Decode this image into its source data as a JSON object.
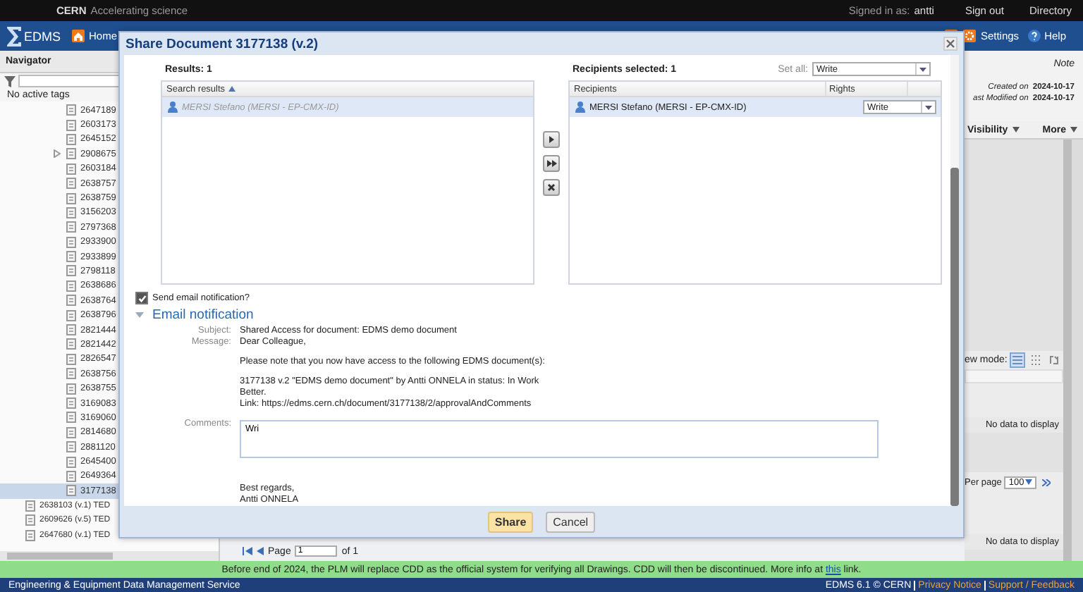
{
  "top_bar": {
    "org": "CERN",
    "tagline": "Accelerating science",
    "signed_in_label": "Signed in as:",
    "user": "antti",
    "links": [
      "Sign out",
      "Directory"
    ]
  },
  "header": {
    "logo": "EDMS",
    "nav": [
      {
        "label": "Home"
      }
    ],
    "tools": [
      {
        "kind": "search"
      },
      {
        "kind": "settings",
        "label": "Settings"
      },
      {
        "kind": "help",
        "label": "Help"
      }
    ]
  },
  "navigator": {
    "title": "Navigator",
    "tags_status": "No active tags",
    "documents": [
      {
        "label": "2647189",
        "has_children": false,
        "selected": false
      },
      {
        "label": "2603173",
        "has_children": false,
        "selected": false
      },
      {
        "label": "2645152",
        "has_children": false,
        "selected": false
      },
      {
        "label": "2908675",
        "has_children": true,
        "selected": false
      },
      {
        "label": "2603184",
        "has_children": false,
        "selected": false
      },
      {
        "label": "2638757",
        "has_children": false,
        "selected": false
      },
      {
        "label": "2638759",
        "has_children": false,
        "selected": false
      },
      {
        "label": "3156203",
        "has_children": false,
        "selected": false
      },
      {
        "label": "2797368",
        "has_children": false,
        "selected": false
      },
      {
        "label": "2933900",
        "has_children": false,
        "selected": false
      },
      {
        "label": "2933899",
        "has_children": false,
        "selected": false
      },
      {
        "label": "2798118",
        "has_children": false,
        "selected": false
      },
      {
        "label": "2638686",
        "has_children": false,
        "selected": false
      },
      {
        "label": "2638764",
        "has_children": false,
        "selected": false
      },
      {
        "label": "2638796",
        "has_children": false,
        "selected": false
      },
      {
        "label": "2821444",
        "has_children": false,
        "selected": false
      },
      {
        "label": "2821442",
        "has_children": false,
        "selected": false
      },
      {
        "label": "2826547",
        "has_children": false,
        "selected": false
      },
      {
        "label": "2638756",
        "has_children": false,
        "selected": false
      },
      {
        "label": "2638755",
        "has_children": false,
        "selected": false
      },
      {
        "label": "3169083",
        "has_children": false,
        "selected": false
      },
      {
        "label": "3169060",
        "has_children": false,
        "selected": false
      },
      {
        "label": "2814680",
        "has_children": false,
        "selected": false
      },
      {
        "label": "2881120",
        "has_children": false,
        "selected": false
      },
      {
        "label": "2645400",
        "has_children": false,
        "selected": false
      },
      {
        "label": "2649364",
        "has_children": false,
        "selected": false
      },
      {
        "label": "3177138",
        "has_children": false,
        "selected": true
      }
    ],
    "parent_documents": [
      {
        "label": "2638103 (v.1) TED",
        "selected": false
      },
      {
        "label": "2609626 (v.5) TED",
        "selected": false
      },
      {
        "label": "2647680 (v.1) TED",
        "selected": false
      }
    ]
  },
  "pager": {
    "page_label": "Page",
    "page": "1",
    "of": "of 1"
  },
  "right_panel": {
    "note": "Note",
    "created_label": "Created on",
    "created": "2024-10-17",
    "modified_label": "ast Modified on",
    "modified": "2024-10-17",
    "menus": [
      "Visibility",
      "More"
    ],
    "view_mode_label": "ew mode:",
    "view_modes": [
      {
        "kind": "list",
        "selected": true
      },
      {
        "kind": "grid",
        "selected": false
      },
      {
        "kind": "export",
        "selected": false
      }
    ],
    "empty_1": "No data to display",
    "per_page_label": "Per page",
    "per_page": "100",
    "empty_2": "No data to display"
  },
  "dialog": {
    "title": "Share Document 3177138 (v.2)",
    "results_label": "Results: 1",
    "search_column": "Search results",
    "sort_ascending": true,
    "search_results": [
      {
        "name": "MERSI Stefano (MERSI - EP-CMX-ID)",
        "selected": true
      }
    ],
    "recipients_label": "Recipients selected: 1",
    "set_all_label": "Set all:",
    "set_all_value": "Write",
    "recipient_columns": [
      "Recipients",
      "Rights"
    ],
    "recipients": [
      {
        "name": "MERSI Stefano (MERSI - EP-CMX-ID)",
        "rights": "Write",
        "selected": true
      }
    ],
    "send_email": {
      "label": "Send email notification?",
      "checked": true
    },
    "email": {
      "title": "Email notification",
      "expanded": true,
      "subject_label": "Subject:",
      "subject": "Shared Access for document: EDMS demo document",
      "message_label": "Message:",
      "message": [
        [
          "Dear Colleague,"
        ],
        [
          "Please note that you now have access to the following EDMS document(s):"
        ],
        [
          "3177138 v.2 \"EDMS demo document\" by Antti ONNELA in status: In Work",
          "Better.",
          "Link: https://edms.cern.ch/document/3177138/2/approvalAndComments"
        ]
      ],
      "comments_label": "Comments:",
      "comments": "Wri",
      "closing": [
        "Best regards,",
        "Antti ONNELA"
      ]
    },
    "buttons": [
      {
        "label": "Share",
        "primary": true
      },
      {
        "label": "Cancel",
        "primary": false
      }
    ]
  },
  "banner": {
    "text": "Before end of 2024, the PLM will replace CDD as the official system for verifying all Drawings. CDD will then be discontinued. More info at",
    "link": "this",
    "after": "link."
  },
  "footer": {
    "service": "Engineering & Equipment Data Management Service",
    "version": "EDMS 6.1 © CERN",
    "links": [
      "Privacy Notice",
      "Support / Feedback"
    ]
  }
}
